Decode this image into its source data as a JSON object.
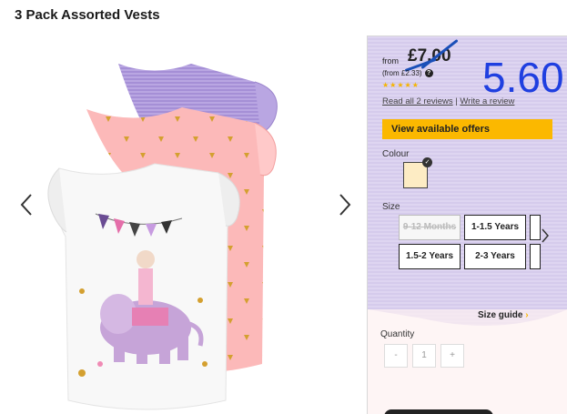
{
  "page": {
    "title": "3 Pack Assorted Vests"
  },
  "gallery": {
    "prev_label": "‹",
    "next_label": "›"
  },
  "price": {
    "from_label": "from",
    "old_price": "£7.00",
    "from_each": "(from £2.33)",
    "new_price": "5.60",
    "rating_stars": "★★★★★",
    "rating_value": 5,
    "read_reviews": "Read all 2 reviews",
    "separator": "|",
    "write_review": "Write a review"
  },
  "offers": {
    "label": "View available offers",
    "color": "#fbb800"
  },
  "colour": {
    "label": "Colour",
    "selected_swatch_color": "#fdecc4"
  },
  "size": {
    "label": "Size",
    "options": [
      {
        "label": "9-12 Months",
        "available": false
      },
      {
        "label": "1-1.5 Years",
        "available": true
      },
      {
        "label": "1.5-2 Years",
        "available": true
      },
      {
        "label": "2-3 Years",
        "available": true
      }
    ],
    "guide_label": "Size guide",
    "guide_arrow": "›"
  },
  "quantity": {
    "label": "Quantity",
    "minus": "-",
    "value": "1",
    "plus": "+"
  },
  "colors": {
    "accent": "#fbb800",
    "overlay_text": "#1f3fe0",
    "strike": "#1a4fb8"
  }
}
